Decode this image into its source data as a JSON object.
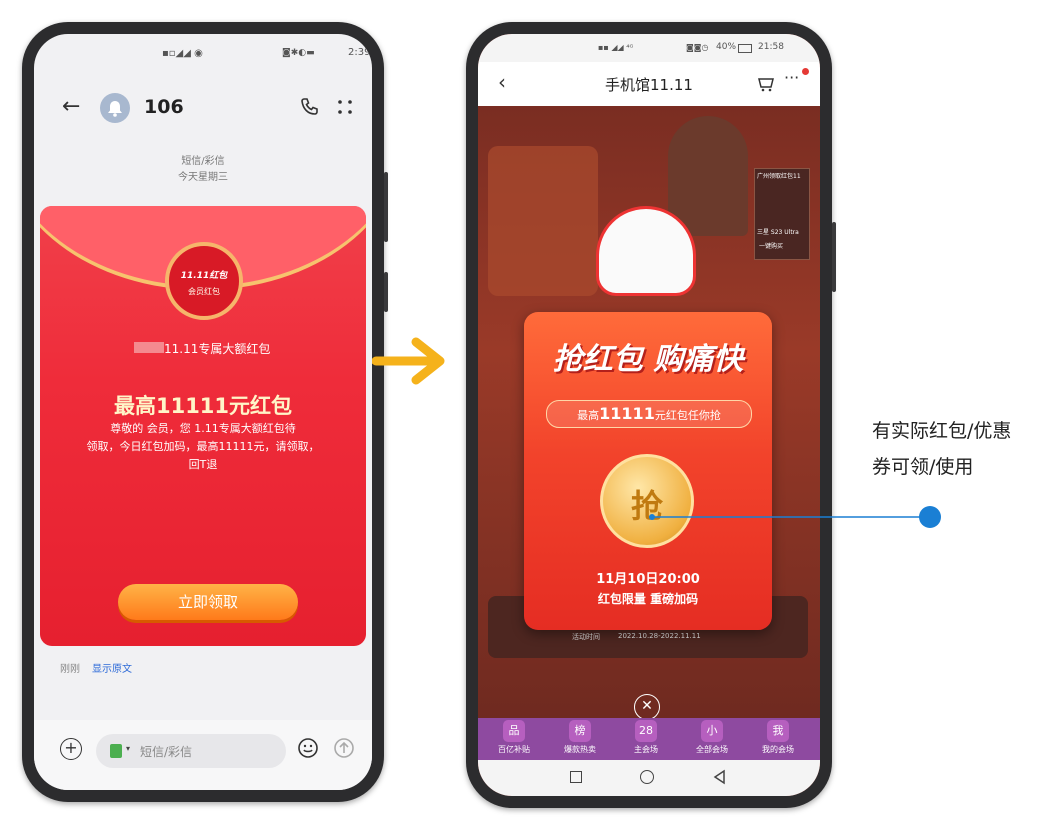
{
  "left_phone": {
    "status_bar": {
      "time": "2:39"
    },
    "header": {
      "contact": "106"
    },
    "thread_meta": {
      "type": "短信/彩信",
      "date": "今天星期三"
    },
    "envelope": {
      "seal_line1": "11.11红包",
      "seal_line2": "会员红包",
      "subtitle": "11.11专属大额红包",
      "headline": "最高11111元红包",
      "body_line1": "尊敬的 会员，您 1.11专属大额红包待",
      "body_line2": "领取，今日红包加码，最高11111元，请领取，",
      "body_line3": "回T退",
      "claim_button": "立即领取"
    },
    "footer_meta": {
      "time": "刚刚",
      "show_original": "显示原文"
    },
    "compose": {
      "placeholder": "短信/彩信"
    }
  },
  "right_phone": {
    "status_bar": {
      "battery": "40%",
      "time": "21:58"
    },
    "nav": {
      "title": "手机馆11.11"
    },
    "popup": {
      "headline": "抢红包 购痛快",
      "subheadline_prefix": "最高",
      "subheadline_amount": "11111",
      "subheadline_suffix": "元红包任你抢",
      "coin_char": "抢",
      "date_line": "11月10日20:00",
      "note_line": "红包限量 重磅加码"
    },
    "behind": {
      "promo_date": "2022.10.28-2022.11.11",
      "promo_label": "活动时间",
      "brand_tag": "广州领取红包11",
      "product_tag": "三星 S23 Ultra",
      "buy_tag": "一键购买"
    },
    "bottom_tabs": [
      {
        "icon": "品",
        "label": "百亿补贴"
      },
      {
        "icon": "榜",
        "label": "爆款热卖"
      },
      {
        "icon": "28",
        "label": "主会场"
      },
      {
        "icon": "小",
        "label": "全部会场"
      },
      {
        "icon": "我",
        "label": "我的会场"
      }
    ]
  },
  "annotation": {
    "line1": "有实际红包/优惠",
    "line2": "券可领/使用"
  },
  "colors": {
    "envelope_red": "#ef2c3a",
    "arrow_orange": "#f5b21b",
    "annotation_blue": "#1a7fd4",
    "popup_orange": "#f2432b"
  }
}
